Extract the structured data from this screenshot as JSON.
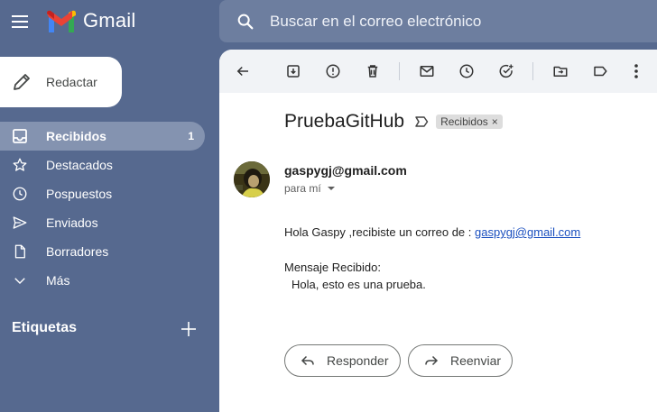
{
  "app": {
    "name": "Gmail"
  },
  "search": {
    "placeholder": "Buscar en el correo electrónico"
  },
  "compose": {
    "label": "Redactar"
  },
  "nav": {
    "items": [
      {
        "label": "Recibidos",
        "count": "1",
        "icon": "inbox-icon"
      },
      {
        "label": "Destacados",
        "count": "",
        "icon": "star-icon"
      },
      {
        "label": "Pospuestos",
        "count": "",
        "icon": "clock-icon"
      },
      {
        "label": "Enviados",
        "count": "",
        "icon": "send-icon"
      },
      {
        "label": "Borradores",
        "count": "",
        "icon": "draft-icon"
      },
      {
        "label": "Más",
        "count": "",
        "icon": "chevron-down-icon"
      }
    ]
  },
  "labels": {
    "title": "Etiquetas"
  },
  "email": {
    "subject": "PruebaGitHub",
    "label_chip": "Recibidos",
    "chip_close": "×",
    "sender": "gaspygj@gmail.com",
    "to": "para mí",
    "greeting": "Hola Gaspy ,recibiste un correo de : ",
    "link": "gaspygj@gmail.com",
    "msg_title": "Mensaje Recibido:",
    "msg_body": "Hola, esto es una prueba."
  },
  "actions": {
    "reply": "Responder",
    "forward": "Reenviar"
  },
  "colors": {
    "sidebar_bg": "#56698f",
    "active_item": "#8493b0",
    "link": "#1a4fbf"
  }
}
